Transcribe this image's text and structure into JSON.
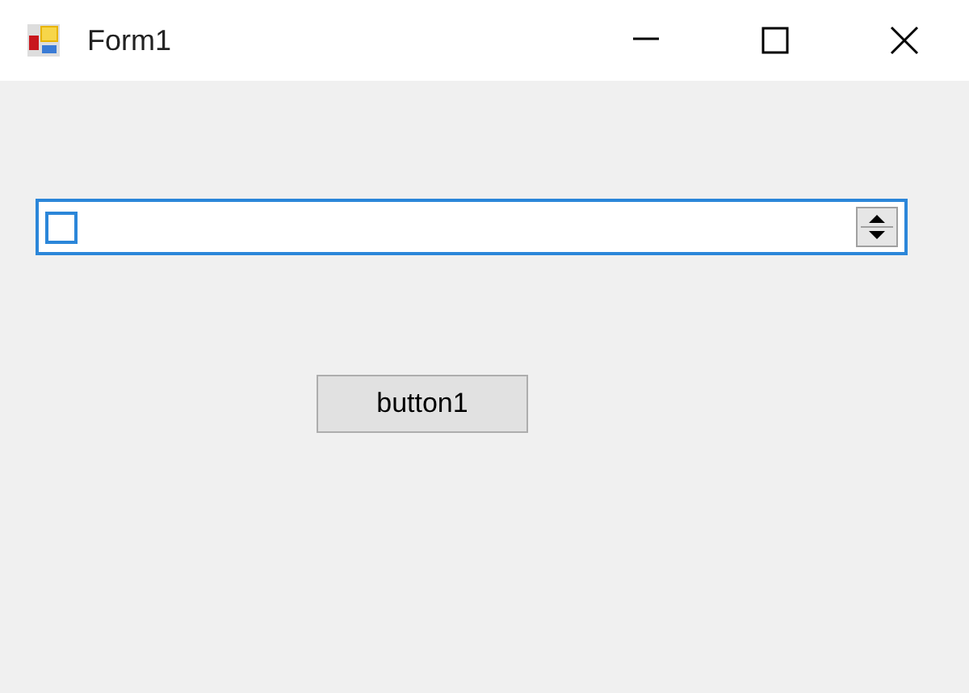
{
  "window": {
    "title": "Form1"
  },
  "spin_field": {
    "focused": true
  },
  "button": {
    "label": "button1"
  }
}
